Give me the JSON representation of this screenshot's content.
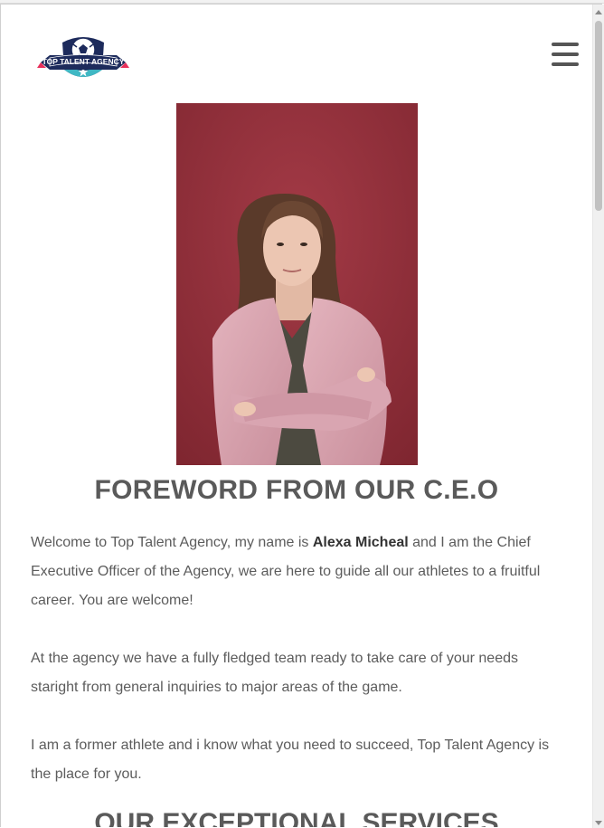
{
  "brand": {
    "logo_text": "TOP TALENT AGENCY",
    "colors": {
      "navy": "#1d2b5c",
      "teal": "#3fb8c4",
      "accent": "#e8305a"
    }
  },
  "nav": {
    "menu_icon": "hamburger-menu-icon"
  },
  "foreword": {
    "title": "FOREWORD FROM OUR C.E.O",
    "p1_before": "Welcome to Top Talent Agency, my name is ",
    "p1_name": "Alexa Micheal",
    "p1_after": " and I am the Chief Executive Officer of the Agency, we are here to guide all our athletes to a fruitful career. You are welcome!",
    "p2": "At the agency we have a fully fledged team ready to take care of your needs staright from general inquiries to major areas of the game.",
    "p3": "I am a former athlete and i know what you need to succeed, Top Talent Agency is the place for you."
  },
  "services": {
    "title": "OUR EXCEPTIONAL SERVICES"
  }
}
